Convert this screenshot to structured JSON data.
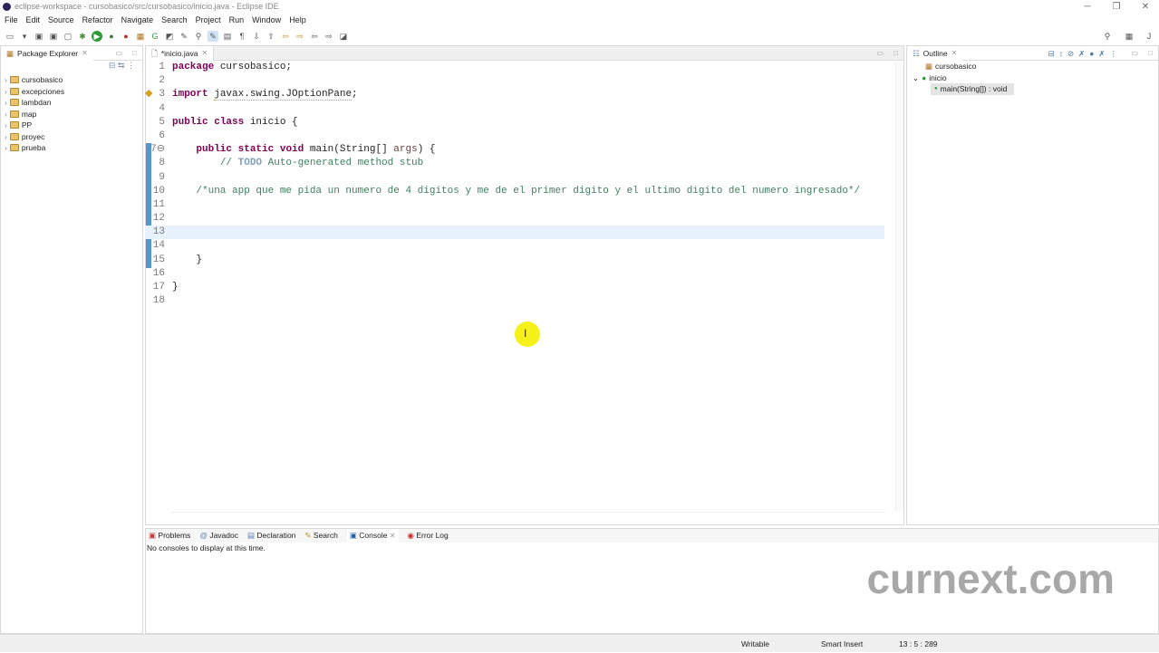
{
  "window": {
    "title": "eclipse-workspace - cursobasico/src/cursobasico/inicio.java - Eclipse IDE"
  },
  "menu": [
    "File",
    "Edit",
    "Source",
    "Refactor",
    "Navigate",
    "Search",
    "Project",
    "Run",
    "Window",
    "Help"
  ],
  "package_explorer": {
    "title": "Package Explorer",
    "projects": [
      "cursobasico",
      "excepciones",
      "lambdan",
      "map",
      "PP",
      "proyec",
      "prueba"
    ]
  },
  "editor": {
    "tab": "*inicio.java",
    "active_line": 13
  },
  "outline": {
    "title": "Outline",
    "package": "cursobasico",
    "class": "inicio",
    "method": "main(String[]) : void"
  },
  "bottom": {
    "tabs": [
      "Problems",
      "Javadoc",
      "Declaration",
      "Search",
      "Console",
      "Error Log"
    ],
    "message": "No consoles to display at this time."
  },
  "status": {
    "mode": "Writable",
    "insert": "Smart Insert",
    "position": "13 : 5 : 289"
  },
  "watermark": "curnext.com"
}
